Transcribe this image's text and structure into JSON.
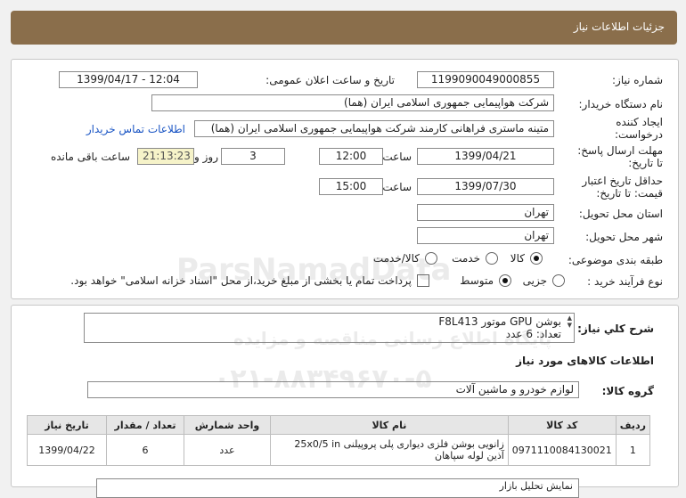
{
  "header": {
    "title": "جزئیات اطلاعات نیاز"
  },
  "form": {
    "need_number": {
      "label": "شماره نیاز:",
      "value": "1199090049000855"
    },
    "announce": {
      "label": "تاریخ و ساعت اعلان عمومی:",
      "value": "1399/04/17 - 12:04"
    },
    "buyer_org": {
      "label": "نام دستگاه خریدار:",
      "value": "شرکت هواپیمایی جمهوری اسلامی ایران (هما)"
    },
    "creator": {
      "label_line1": "ایجاد کننده",
      "label_line2": "درخواست:",
      "value": "متینه ماستری فراهانی کارمند شرکت هواپیمایی جمهوری اسلامی ایران (هما)",
      "contact_link": "اطلاعات تماس خریدار"
    },
    "deadline": {
      "label_line1": "مهلت ارسال پاسخ:",
      "label_line2": "تا تاریخ:",
      "date": "1399/04/21",
      "time_label": "ساعت",
      "time": "12:00",
      "days": "3",
      "days_label": "روز و",
      "remaining": "21:13:23",
      "remaining_label": "ساعت باقی مانده"
    },
    "validity": {
      "label_line1": "حداقل تاریخ اعتبار",
      "label_line2": "قیمت: تا تاریخ:",
      "date": "1399/07/30",
      "time_label": "ساعت",
      "time": "15:00"
    },
    "province": {
      "label": "استان محل تحویل:",
      "value": "تهران"
    },
    "city": {
      "label": "شهر محل تحویل:",
      "value": "تهران"
    },
    "category": {
      "label": "طبقه بندی موضوعی:",
      "options": [
        "کالا",
        "خدمت",
        "کالا/خدمت"
      ],
      "selected": "کالا"
    },
    "purchase": {
      "label": "نوع فرآیند خرید :",
      "options": [
        "جزیی",
        "متوسط"
      ],
      "selected": "متوسط",
      "note": "پرداخت تمام یا بخشی از مبلغ خرید،از محل \"اسناد خزانه اسلامی\" خواهد بود."
    }
  },
  "summary": {
    "label": "شرح کلي نياز:",
    "line1": "بوشن GPU موتور F8L413",
    "line2": "تعداد: 6 عدد"
  },
  "goods": {
    "section_title": "اطلاعات کالاهای مورد نیاز",
    "group_label": "گروه کالا:",
    "group_value": "لوازم خودرو و ماشین آلات",
    "columns": [
      "ردیف",
      "کد کالا",
      "نام کالا",
      "واحد شمارش",
      "تعداد / مقدار",
      "تاریخ نیاز"
    ],
    "rows": [
      {
        "row": "1",
        "code": "0971110084130021",
        "name": "زانویی بوشن فلزی دیواری پلی پروپیلنی 25x0/5 in آذین لوله سپاهان",
        "unit": "عدد",
        "qty": "6",
        "date": "1399/04/22"
      }
    ]
  },
  "watermark": {
    "brand": "ParsNamadData",
    "line1": "پایگاه اطلاع رسانی مناقصه و مزایده",
    "phone": "۰۲۱-۸۸۳۴۹۶۷۰-۵"
  },
  "bottom_partial": "نمایش تحلیل بازار"
}
